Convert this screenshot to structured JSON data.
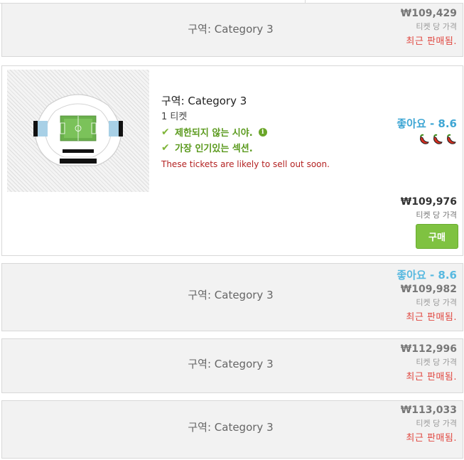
{
  "listings": [
    {
      "section": "구역: Category 3",
      "price": "₩109,429",
      "per_ticket": "티켓 당 가격",
      "status": "최근 판매됨."
    },
    {
      "section": "구역: Category 3",
      "rating": "좋아요 - 8.6",
      "price": "₩109,982",
      "per_ticket": "티켓 당 가격",
      "status": "최근 판매됨."
    },
    {
      "section": "구역: Category 3",
      "price": "₩112,996",
      "per_ticket": "티켓 당 가격",
      "status": "최근 판매됨."
    },
    {
      "section": "구역: Category 3",
      "price": "₩113,033",
      "per_ticket": "티켓 당 가격",
      "status": "최근 판매됨."
    }
  ],
  "featured": {
    "section": "구역: Category 3",
    "ticket_count": "1 티켓",
    "features": [
      "제한되지 않는 시야.",
      "가장 인기있는 섹션."
    ],
    "warning": "These tickets are likely to sell out soon.",
    "rating": "좋아요 - 8.6",
    "price": "₩109,976",
    "per_ticket": "티켓 당 가격",
    "buy_label": "구매",
    "chili_count": 3
  },
  "colors": {
    "buy_button": "#7fc241",
    "feature_green": "#5b9a1e",
    "warning_red": "#b42323",
    "sold_red": "#e0463f",
    "rating_blue": "#3ea6d4"
  },
  "icons": {
    "check": "check-icon",
    "info": "info-icon",
    "chili": "chili-pepper-icon"
  }
}
